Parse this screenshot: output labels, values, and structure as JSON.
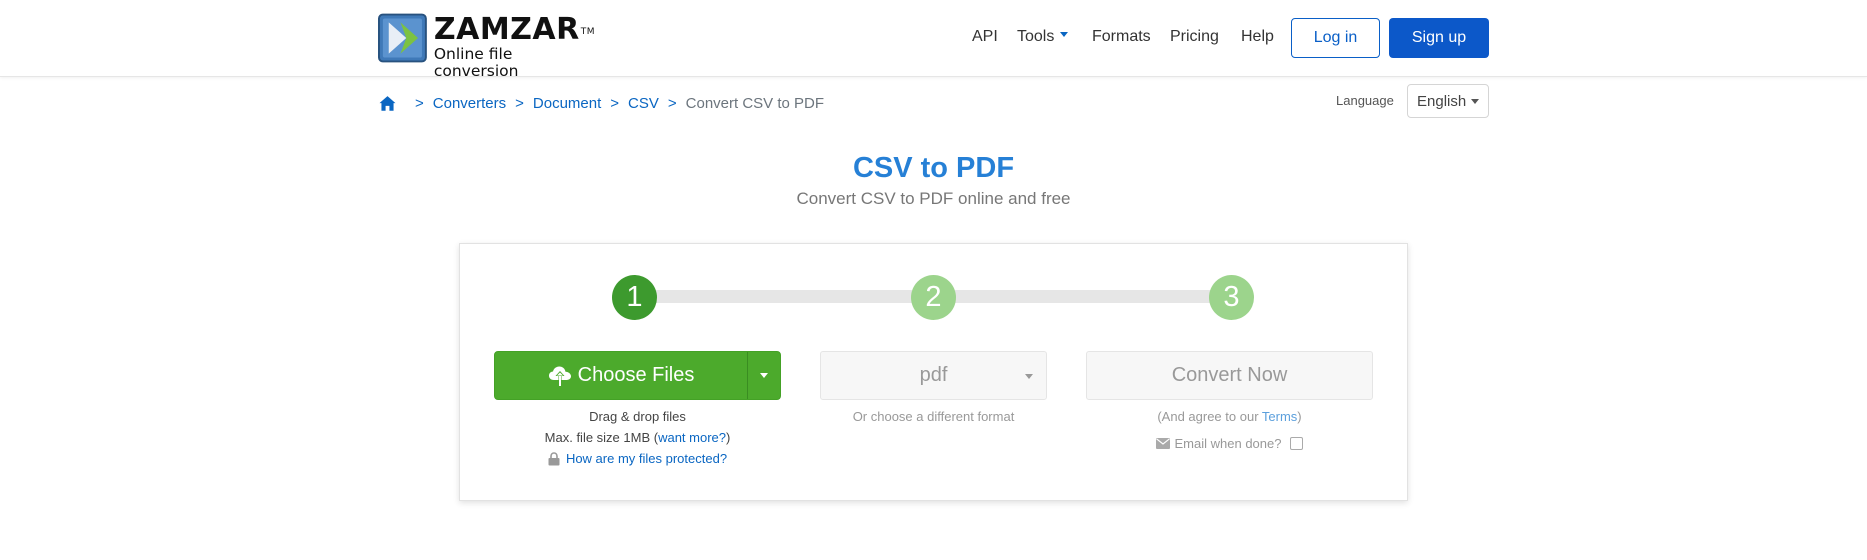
{
  "brand": {
    "name": "ZAMZAR",
    "trademark": "TM",
    "tagline": "Online file conversion"
  },
  "nav": {
    "api": "API",
    "tools": "Tools",
    "formats": "Formats",
    "pricing": "Pricing",
    "help": "Help",
    "login": "Log in",
    "signup": "Sign up"
  },
  "breadcrumb": {
    "items": [
      "Converters",
      "Document",
      "CSV"
    ],
    "separator": ">",
    "current": "Convert CSV to PDF"
  },
  "language": {
    "label": "Language",
    "selected": "English"
  },
  "page": {
    "title": "CSV to PDF",
    "subtitle": "Convert CSV to PDF online and free"
  },
  "steps": {
    "numbers": [
      "1",
      "2",
      "3"
    ],
    "choose_files_label": "Choose Files",
    "drag_drop": "Drag & drop files",
    "max_size_prefix": "Max. file size 1MB (",
    "want_more": "want more?",
    "max_size_suffix": ")",
    "protected_link": "How are my files protected?",
    "format_selected": "pdf",
    "format_hint": "Or choose a different format",
    "convert_label": "Convert Now",
    "agree_prefix": "(And agree to our ",
    "terms": "Terms",
    "agree_suffix": ")",
    "email_label": "Email when done?"
  },
  "colors": {
    "brand_blue": "#0c58c9",
    "title_blue": "#2680d6",
    "step_active": "#3d9a2e",
    "step_inactive": "#9cd48c",
    "choose_green": "#4caa2c"
  },
  "icons": [
    "home-icon",
    "upload-cloud-icon",
    "lock-icon",
    "envelope-icon",
    "chevron-down-icon"
  ]
}
